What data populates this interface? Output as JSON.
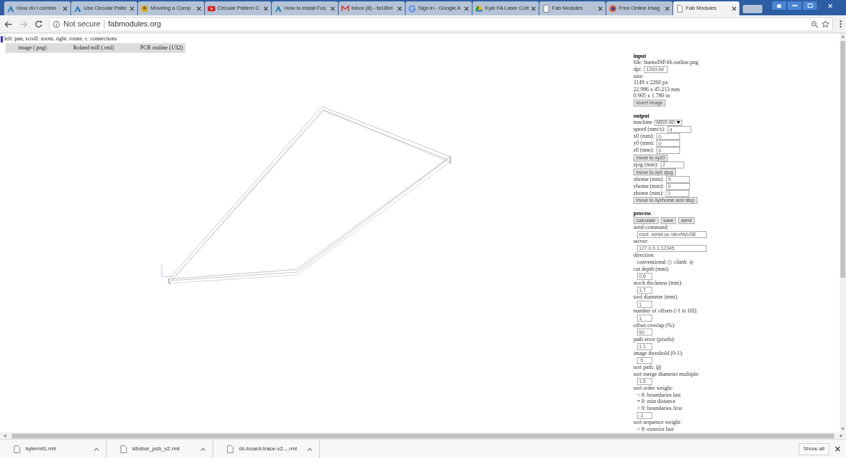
{
  "tabs": [
    {
      "kind": "autodesk",
      "title": "How do I combin",
      "selected": false
    },
    {
      "kind": "autodesk",
      "title": "Use Circular Patte",
      "selected": false
    },
    {
      "kind": "avatar",
      "title": "Moveing a Comp",
      "selected": false
    },
    {
      "kind": "video",
      "title": "Circular Pattern C",
      "selected": false
    },
    {
      "kind": "autodesk",
      "title": "How to install Fus",
      "selected": false
    },
    {
      "kind": "mail",
      "title": "Inbox (8) - fa18bri",
      "selected": false
    },
    {
      "kind": "search",
      "title": "Sign in - Google A",
      "selected": false
    },
    {
      "kind": "drive",
      "title": "Kyle FA Laser Cutt",
      "selected": false
    },
    {
      "kind": "page",
      "title": "Fab Modules",
      "selected": false
    },
    {
      "kind": "globe",
      "title": "Free Online Imag",
      "selected": false
    },
    {
      "kind": "page",
      "title": "Fab Modules",
      "selected": true
    }
  ],
  "address": {
    "security": "Not secure",
    "url": "fabmodules.org"
  },
  "hint": "left: pan, scroll: zoom, right: rotate, c: connections",
  "menu": [
    "image (.png)",
    "Roland mill (.rml)",
    "PCB outline (1/32)"
  ],
  "panel": [
    {
      "kind": "heading",
      "text": "input"
    },
    {
      "kind": "text",
      "text": "file: buenoISP.44.outline.png"
    },
    {
      "kind": "field",
      "label": "dpi:",
      "value": "1269.64"
    },
    {
      "kind": "text",
      "text": "size:"
    },
    {
      "kind": "text",
      "text": "1149 x 2260 px"
    },
    {
      "kind": "text",
      "text": "22.986 x 45.213 mm"
    },
    {
      "kind": "text",
      "text": "0.905 x 1.780 in"
    },
    {
      "kind": "buttons",
      "buttons": [
        "invert image"
      ]
    },
    {
      "kind": "heading",
      "text": "output"
    },
    {
      "kind": "select",
      "label": "machine",
      "value": "MDX-40"
    },
    {
      "kind": "field",
      "label": "speed (mm/s):",
      "value": "4"
    },
    {
      "kind": "field",
      "label": "x0 (mm):",
      "value": "0"
    },
    {
      "kind": "field",
      "label": "y0 (mm):",
      "value": "0"
    },
    {
      "kind": "field",
      "label": "z0 (mm):",
      "value": "0"
    },
    {
      "kind": "buttons",
      "buttons": [
        "move to xyz0"
      ]
    },
    {
      "kind": "field",
      "label": "zjog (mm):",
      "value": "2"
    },
    {
      "kind": "buttons",
      "buttons": [
        "move to xy0 zjog"
      ]
    },
    {
      "kind": "field",
      "label": "xhome (mm):",
      "value": "0"
    },
    {
      "kind": "field",
      "label": "yhome (mm):",
      "value": "0"
    },
    {
      "kind": "field",
      "label": "zhome (mm):",
      "value": "0"
    },
    {
      "kind": "buttons",
      "buttons": [
        "move to xyzhome and stop"
      ]
    },
    {
      "kind": "heading",
      "text": "process"
    },
    {
      "kind": "buttons",
      "buttons": [
        "calculate",
        "save",
        "send"
      ]
    },
    {
      "kind": "text",
      "text": "send command:"
    },
    {
      "kind": "input",
      "value": "mod_serial.py /dev/ttyUSE",
      "wide": true
    },
    {
      "kind": "text",
      "text": "server:"
    },
    {
      "kind": "input",
      "value": "127.0.0.1:12345",
      "wide": true
    },
    {
      "kind": "text",
      "text": "direction:"
    },
    {
      "kind": "radio",
      "options": [
        {
          "label": "conventional",
          "selected": false
        },
        {
          "label": "climb",
          "selected": true
        }
      ]
    },
    {
      "kind": "text",
      "text": "cut depth (mm):"
    },
    {
      "kind": "input",
      "value": "0.6",
      "wide": false
    },
    {
      "kind": "text",
      "text": "stock thickness (mm):"
    },
    {
      "kind": "input",
      "value": "1.7",
      "wide": false
    },
    {
      "kind": "text",
      "text": "tool diameter (mm):"
    },
    {
      "kind": "input",
      "value": "1",
      "wide": false
    },
    {
      "kind": "text",
      "text": "number of offsets (-1 to fill):"
    },
    {
      "kind": "input",
      "value": "1",
      "wide": false
    },
    {
      "kind": "text",
      "text": "offset overlap (%):"
    },
    {
      "kind": "input",
      "value": "50",
      "wide": false
    },
    {
      "kind": "text",
      "text": "path error (pixels):"
    },
    {
      "kind": "input",
      "value": "1.1",
      "wide": false
    },
    {
      "kind": "text",
      "text": "image threshold (0-1):"
    },
    {
      "kind": "input",
      "value": ".5",
      "wide": false
    },
    {
      "kind": "checkbox",
      "label": "sort path:",
      "checked": true
    },
    {
      "kind": "text",
      "text": "sort merge diameter multiple:"
    },
    {
      "kind": "input",
      "value": "1.5",
      "wide": false
    },
    {
      "kind": "text",
      "text": "sort order weight:"
    },
    {
      "kind": "note",
      "text": "< 0: boundaries last"
    },
    {
      "kind": "note",
      "text": "= 0: min distance"
    },
    {
      "kind": "note",
      "text": "> 0: boundaries first"
    },
    {
      "kind": "input",
      "value": "-1",
      "wide": false
    },
    {
      "kind": "text",
      "text": "sort sequence weight:"
    },
    {
      "kind": "note",
      "text": "< 0: exterior last"
    }
  ],
  "downloads": [
    {
      "name": "kylerml1.rml"
    },
    {
      "name": "kitobor_pcb_v2.rml"
    },
    {
      "name": "dc-board-trace-v2....rml"
    }
  ],
  "show_all": "Show all"
}
